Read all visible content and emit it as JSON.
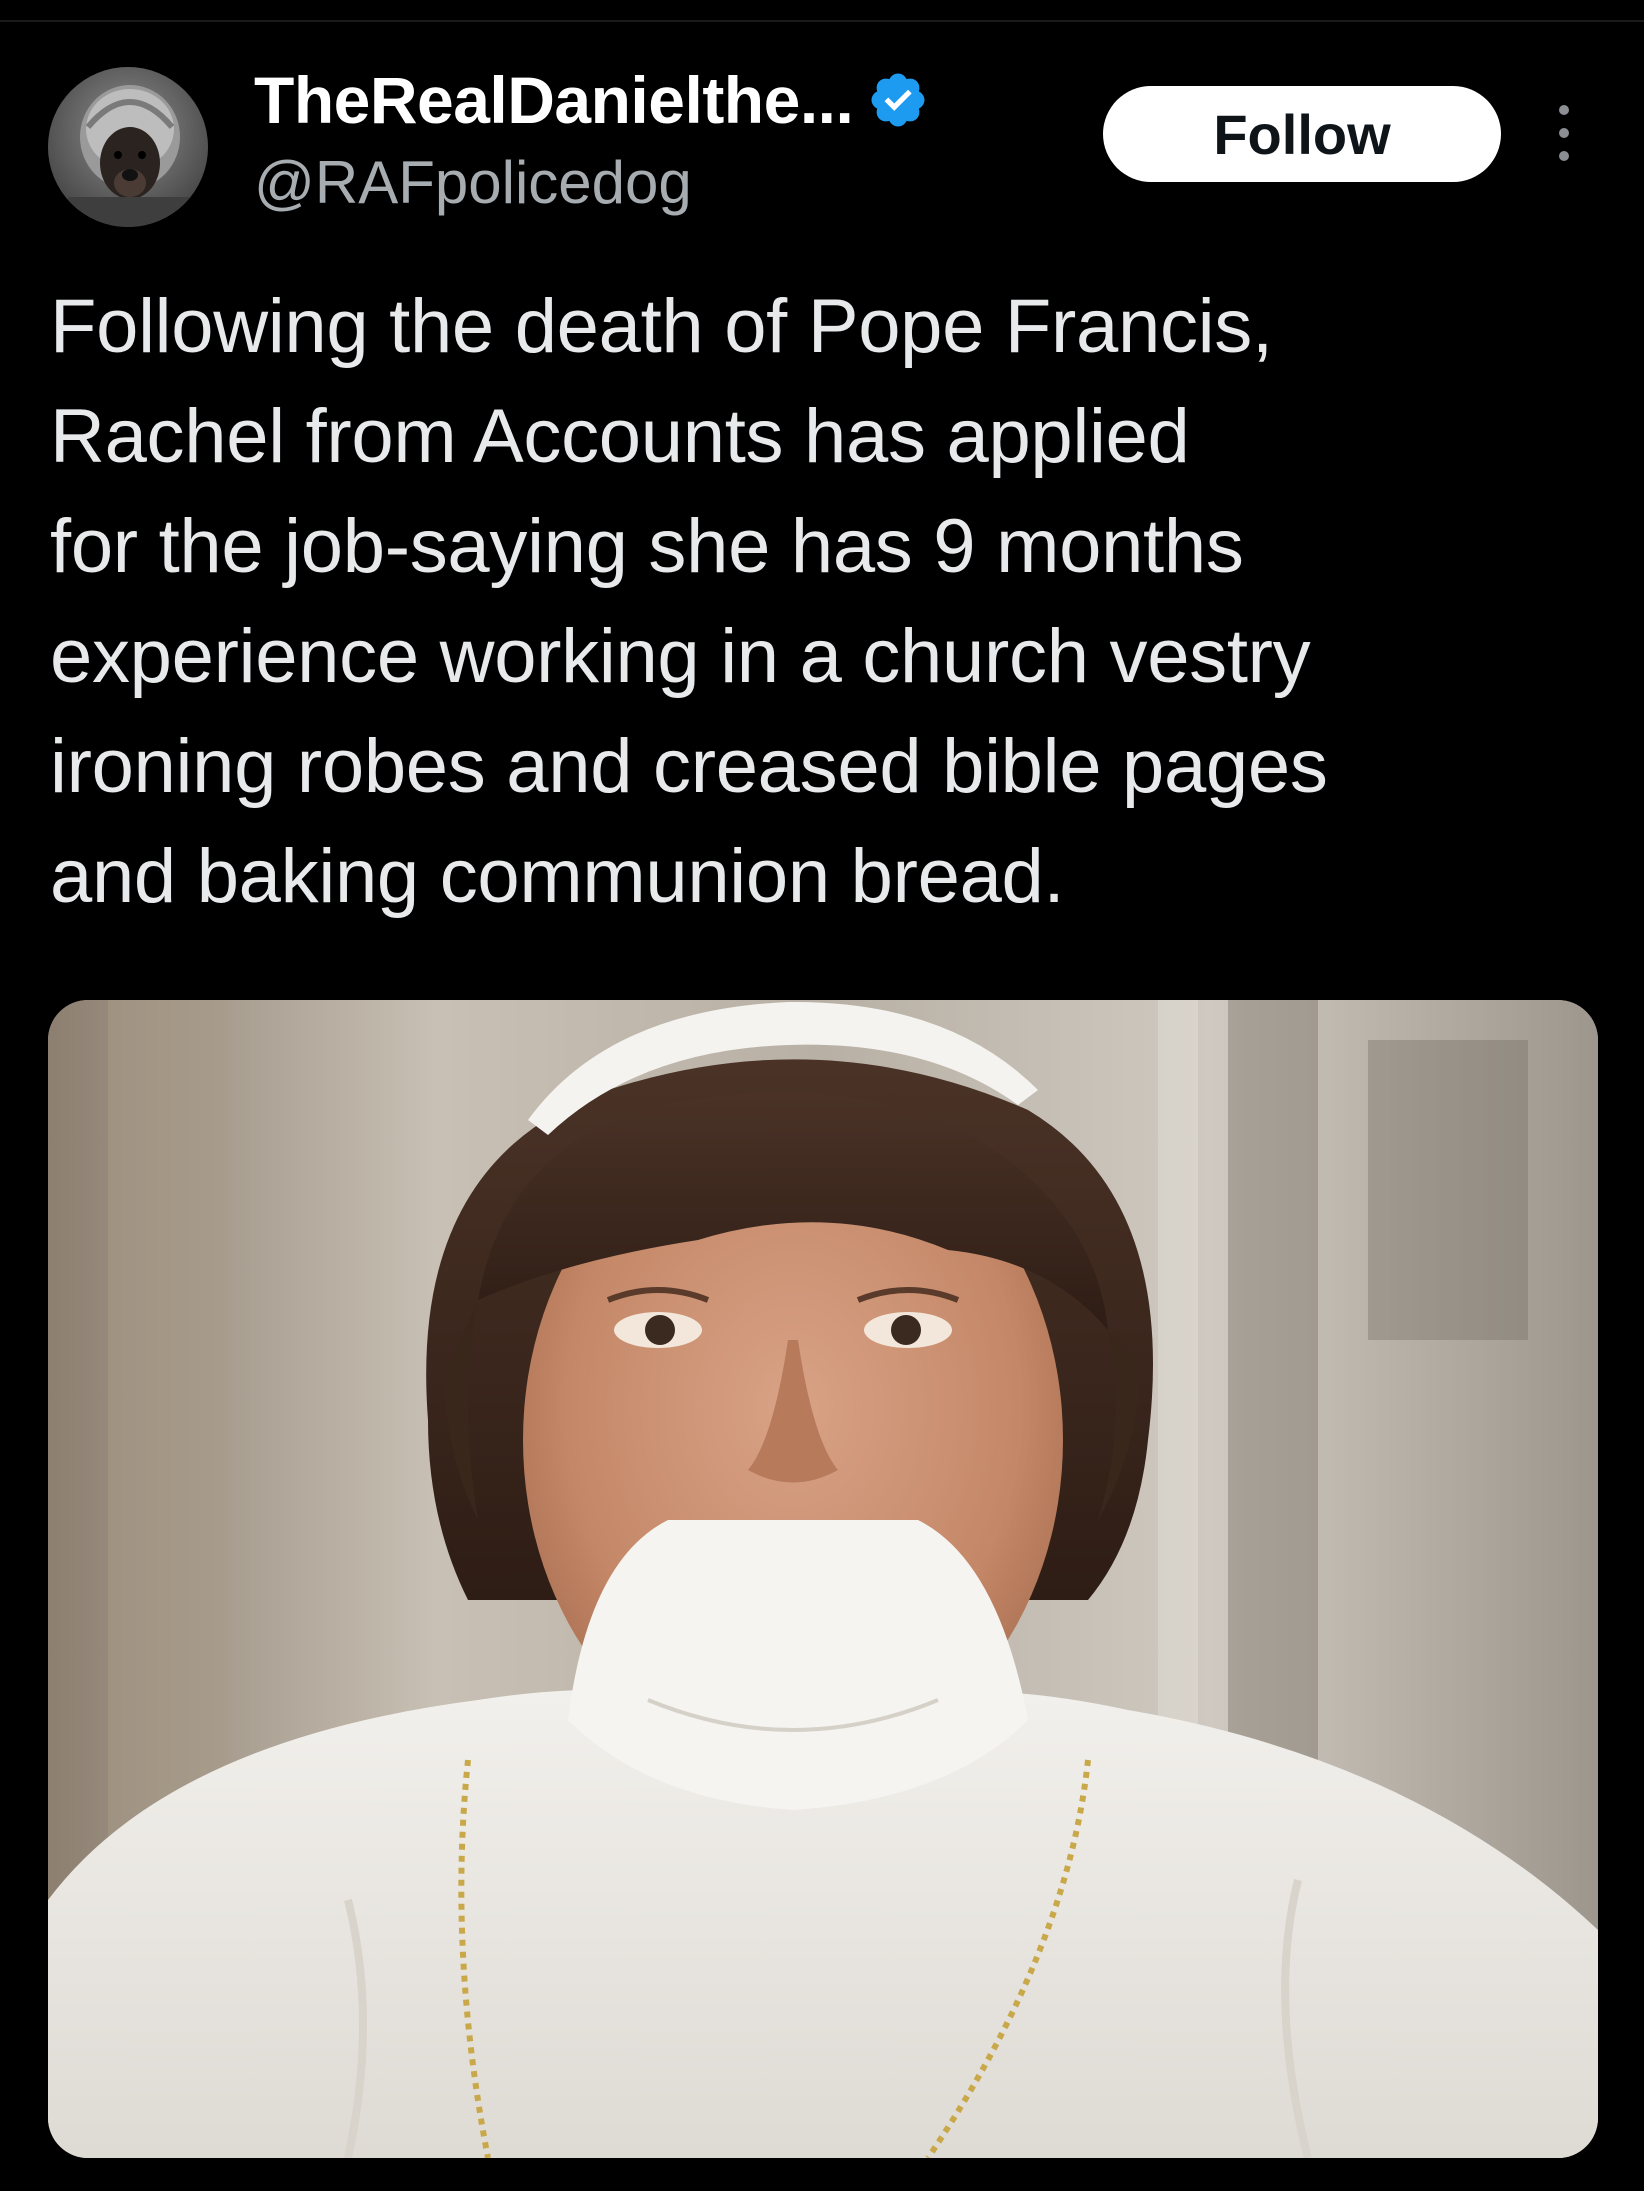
{
  "header": {
    "display_name": "TheRealDanielthe...",
    "handle": "@RAFpolicedog",
    "follow_label": "Follow",
    "avatar_icon": "dog-avatar",
    "verified_icon": "verified-badge-icon",
    "more_icon": "more-options-icon"
  },
  "tweet": {
    "lines": [
      "Following the death of Pope Francis,",
      "Rachel from Accounts has applied",
      "for the job-saying she has 9 months",
      "experience working in a church vestry",
      "ironing robes and creased bible pages",
      "and baking communion bread."
    ]
  },
  "media": {
    "kind": "photo"
  },
  "colors": {
    "background": "#000000",
    "text": "#e7e9ea",
    "handle": "#a7acb1",
    "verified": "#1d9bf0",
    "follow_bg": "#ffffff",
    "follow_text": "#0f1419"
  }
}
